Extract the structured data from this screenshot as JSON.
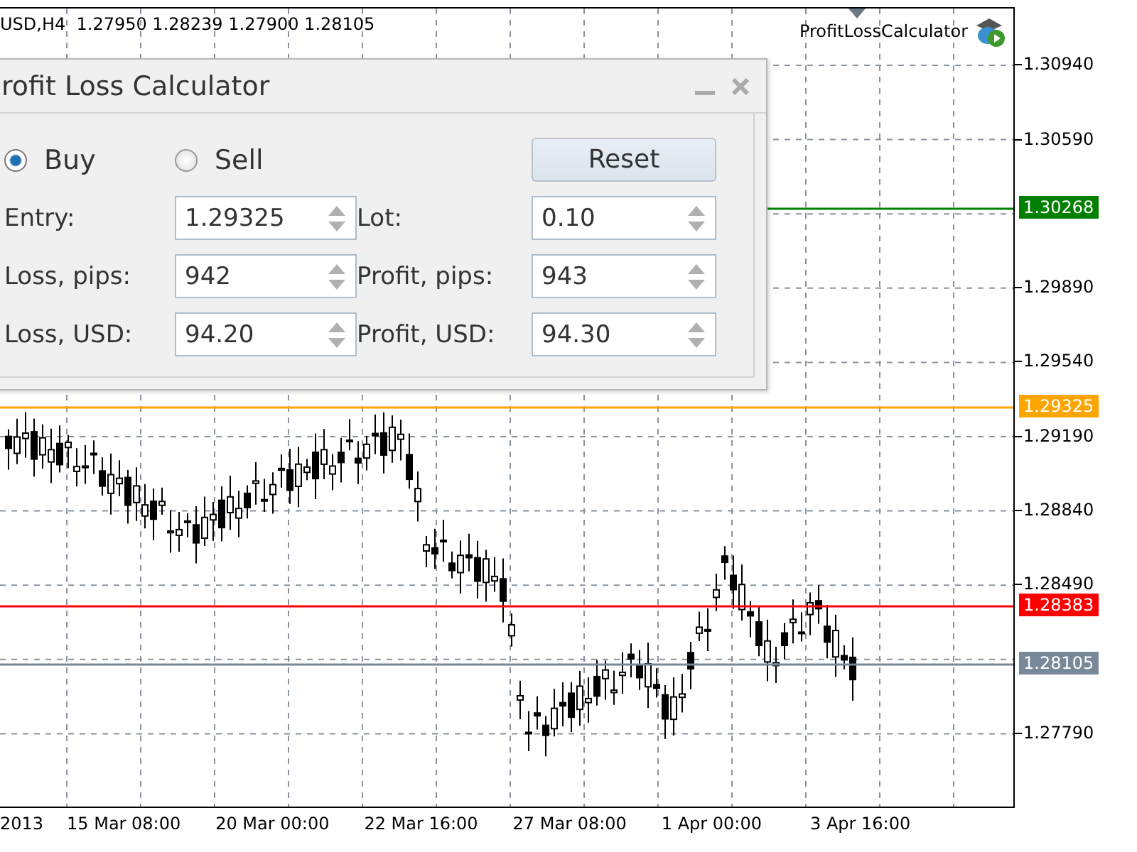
{
  "chart": {
    "symbol_info": "USD,H4  1.27950 1.28239 1.27900 1.28105",
    "indicator_label": "ProfitLossCalculator",
    "price_axis": [
      "1.30940",
      "1.30590",
      "1.29890",
      "1.29540",
      "1.29190",
      "1.28840",
      "1.28490",
      "1.27790"
    ],
    "price_lines": [
      {
        "label": "1.30268",
        "color": "#008000"
      },
      {
        "label": "1.29325",
        "color": "#ffa500"
      },
      {
        "label": "1.28383",
        "color": "#ff0000"
      },
      {
        "label": "1.28105",
        "color": "#778899"
      }
    ],
    "time_axis": [
      "2013",
      "15 Mar 08:00",
      "20 Mar 00:00",
      "22 Mar 16:00",
      "27 Mar 08:00",
      "1 Apr 00:00",
      "3 Apr 16:00"
    ]
  },
  "dialog": {
    "title": "rofit Loss Calculator",
    "direction": [
      {
        "label": "Buy",
        "selected": true
      },
      {
        "label": "Sell",
        "selected": false
      }
    ],
    "reset_button": "Reset",
    "fields": [
      {
        "label": "Entry:",
        "value": "1.29325"
      },
      {
        "label": "Lot:",
        "value": "0.10"
      },
      {
        "label": "Loss, pips:",
        "value": "942"
      },
      {
        "label": "Profit, pips:",
        "value": "943"
      },
      {
        "label": "Loss, USD:",
        "value": "94.20"
      },
      {
        "label": "Profit, USD:",
        "value": "94.30"
      }
    ]
  }
}
